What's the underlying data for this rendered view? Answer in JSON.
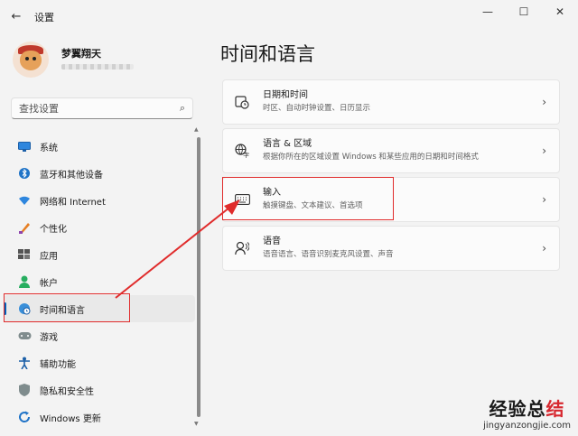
{
  "app": {
    "title": "设置",
    "back_icon": "back-arrow-icon"
  },
  "window_controls": {
    "minimize": "—",
    "maximize": "☐",
    "close": "✕"
  },
  "profile": {
    "name": "梦翼翔天"
  },
  "search": {
    "placeholder": "查找设置"
  },
  "sidebar": {
    "items": [
      {
        "label": "系统",
        "icon": "monitor-icon"
      },
      {
        "label": "蓝牙和其他设备",
        "icon": "bluetooth-icon"
      },
      {
        "label": "网络和 Internet",
        "icon": "wifi-icon"
      },
      {
        "label": "个性化",
        "icon": "brush-icon"
      },
      {
        "label": "应用",
        "icon": "apps-icon"
      },
      {
        "label": "帐户",
        "icon": "account-icon"
      },
      {
        "label": "时间和语言",
        "icon": "globe-clock-icon",
        "active": true
      },
      {
        "label": "游戏",
        "icon": "gamepad-icon"
      },
      {
        "label": "辅助功能",
        "icon": "accessibility-icon"
      },
      {
        "label": "隐私和安全性",
        "icon": "shield-icon"
      },
      {
        "label": "Windows 更新",
        "icon": "update-icon"
      }
    ]
  },
  "main": {
    "title": "时间和语言",
    "cards": [
      {
        "title": "日期和时间",
        "desc": "时区、自动时钟设置、日历显示",
        "icon": "calendar-clock-icon"
      },
      {
        "title": "语言 & 区域",
        "desc": "根据你所在的区域设置 Windows 和某些应用的日期和时间格式",
        "icon": "language-icon"
      },
      {
        "title": "输入",
        "desc": "触摸键盘、文本建议、首选项",
        "icon": "keyboard-icon"
      },
      {
        "title": "语音",
        "desc": "语音语言、语音识别麦克风设置、声音",
        "icon": "speech-icon"
      }
    ]
  },
  "colors": {
    "accent": "#005fb8",
    "annotation": "#e02b2b"
  },
  "watermark": {
    "cn_main": "经验总",
    "cn_last": "结",
    "en": "jingyanzongjie.com"
  }
}
